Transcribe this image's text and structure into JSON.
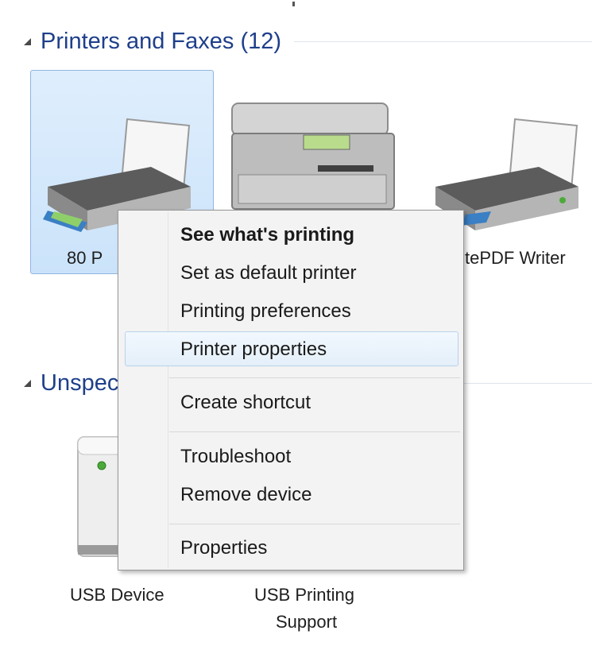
{
  "groups": {
    "printers": {
      "title": "Printers and Faxes (12)"
    },
    "unspecified": {
      "title": "Unspec"
    }
  },
  "devices": {
    "printer1": {
      "label": "80 P"
    },
    "printer3": {
      "label": "tePDF Writer"
    },
    "usb_device": {
      "label": "USB Device"
    },
    "usb_printing": {
      "label_line1": "USB Printing",
      "label_line2": "Support"
    }
  },
  "context_menu": {
    "items": [
      {
        "label": "See what's printing"
      },
      {
        "label": "Set as default printer"
      },
      {
        "label": "Printing preferences"
      },
      {
        "label": "Printer properties"
      },
      {
        "label": "Create shortcut"
      },
      {
        "label": "Troubleshoot"
      },
      {
        "label": "Remove device"
      },
      {
        "label": "Properties"
      }
    ]
  }
}
